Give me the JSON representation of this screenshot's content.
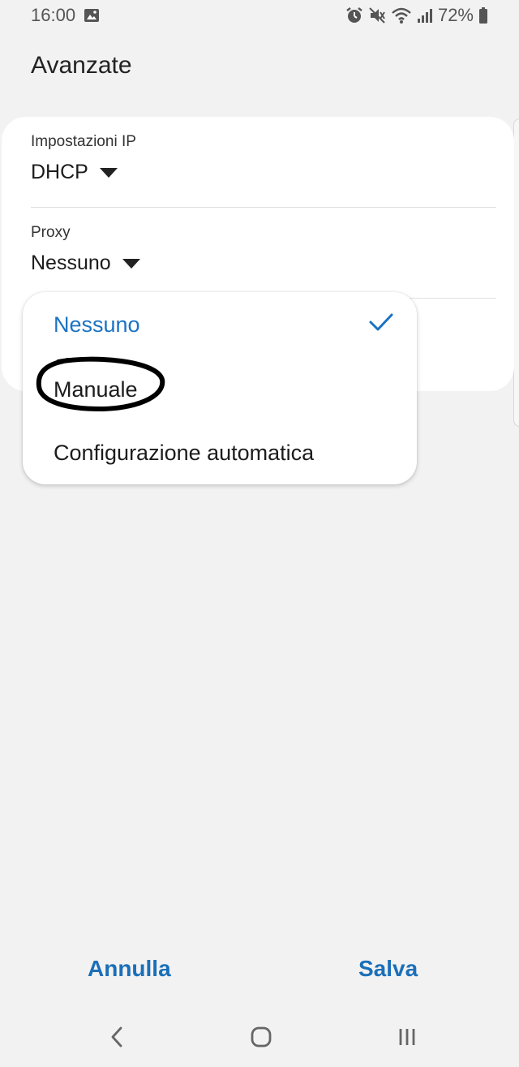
{
  "status_bar": {
    "time": "16:00",
    "battery_percent": "72%",
    "icons": [
      "image-icon",
      "alarm-icon",
      "mute-icon",
      "wifi-icon",
      "signal-icon",
      "battery-icon"
    ]
  },
  "page": {
    "title": "Avanzate"
  },
  "settings": {
    "ip": {
      "label": "Impostazioni IP",
      "value": "DHCP"
    },
    "proxy": {
      "label": "Proxy",
      "value": "Nessuno"
    }
  },
  "dropdown": {
    "options": [
      {
        "label": "Nessuno",
        "selected": true
      },
      {
        "label": "Manuale",
        "selected": false
      },
      {
        "label": "Configurazione automatica",
        "selected": false
      }
    ],
    "accent_color": "#1a73c4"
  },
  "buttons": {
    "cancel_label": "Annulla",
    "save_label": "Salva",
    "color": "#1a6fb8"
  },
  "nav": {
    "icons": [
      "back-icon",
      "home-icon",
      "recent-apps-icon"
    ]
  }
}
